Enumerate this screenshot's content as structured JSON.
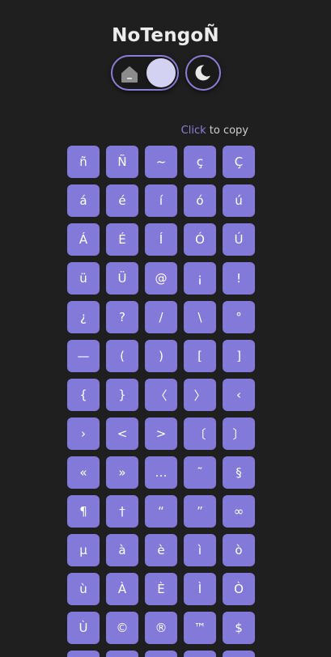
{
  "app": {
    "title": "NoTengoÑ"
  },
  "theme_toggle": {
    "left_icon": "home-icon",
    "right_icon": "moon-icon"
  },
  "hint": {
    "action": "Click",
    "rest": " to copy"
  },
  "colors": {
    "background": "#1f1f1f",
    "accent": "#8279d8",
    "accent_border": "#8a7fd6",
    "knob": "#d4d2f2"
  },
  "characters": [
    "ñ",
    "Ñ",
    "~",
    "ç",
    "Ç",
    "á",
    "é",
    "í",
    "ó",
    "ú",
    "Á",
    "É",
    "Í",
    "Ó",
    "Ú",
    "ü",
    "Ü",
    "@",
    "¡",
    "!",
    "¿",
    "?",
    "/",
    "\\",
    "°",
    "—",
    "(",
    ")",
    "[",
    "]",
    "{",
    "}",
    "〈",
    "〉",
    "‹",
    "›",
    "<",
    ">",
    "〔",
    "〕",
    "«",
    "»",
    "…",
    "˜",
    "§",
    "¶",
    "†",
    "“",
    "”",
    "∞",
    "µ",
    "à",
    "è",
    "ì",
    "ò",
    "ù",
    "À",
    "È",
    "Ì",
    "Ò",
    "Ù",
    "©",
    "®",
    "™",
    "$",
    "",
    "",
    "",
    "",
    ""
  ]
}
